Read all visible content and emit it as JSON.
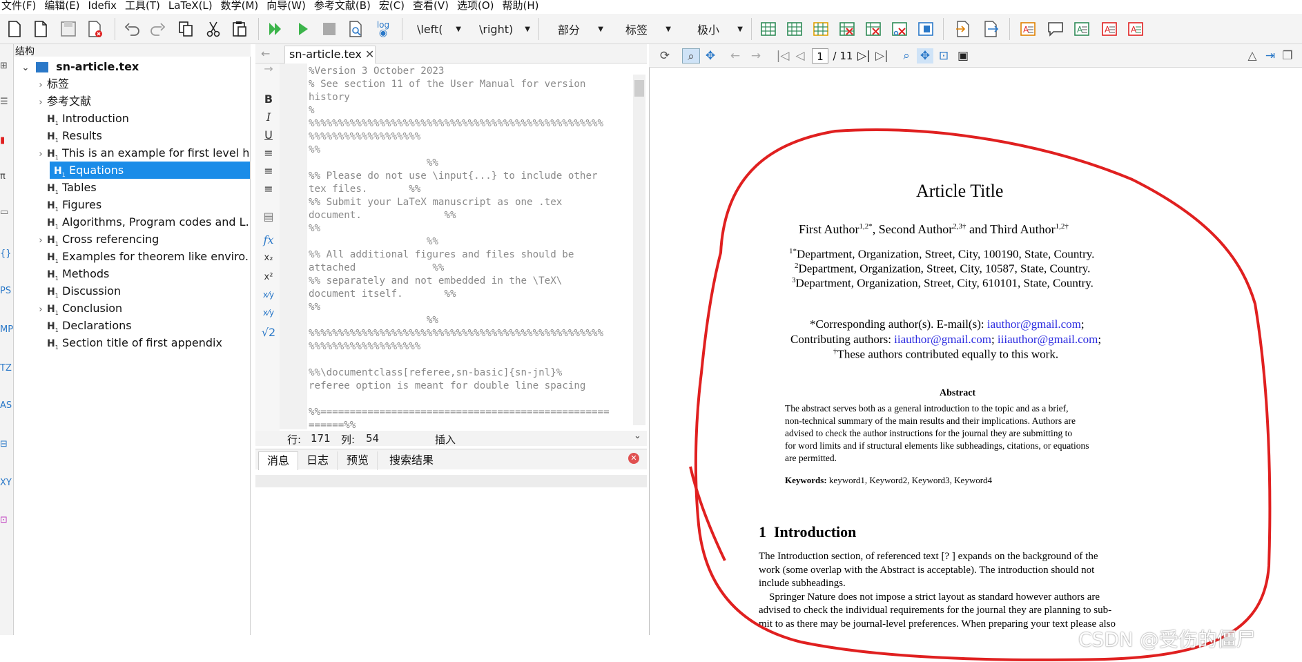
{
  "menu": [
    "文件(F)",
    "编辑(E)",
    "Idefix",
    "工具(T)",
    "LaTeX(L)",
    "数学(M)",
    "向导(W)",
    "参考文献(B)",
    "宏(C)",
    "查看(V)",
    "选项(O)",
    "帮助(H)"
  ],
  "toolbar": {
    "left_combo": "\\left(",
    "right_combo": "\\right)",
    "section_combo": "部分",
    "label_combo": "标签",
    "size_combo": "极小",
    "log_label": "log"
  },
  "structure": {
    "title": "结构",
    "root": "sn-article.tex",
    "items": [
      {
        "label": "标签",
        "kind": "folder",
        "expandable": true
      },
      {
        "label": "参考文献",
        "kind": "folder",
        "expandable": true
      },
      {
        "label": "Introduction",
        "kind": "heading",
        "expandable": false
      },
      {
        "label": "Results",
        "kind": "heading",
        "expandable": false
      },
      {
        "label": "This is an example for first level h...",
        "kind": "heading",
        "expandable": true
      },
      {
        "label": "Equations",
        "kind": "heading",
        "expandable": false,
        "selected": true
      },
      {
        "label": "Tables",
        "kind": "heading",
        "expandable": false
      },
      {
        "label": "Figures",
        "kind": "heading",
        "expandable": false
      },
      {
        "label": "Algorithms, Program codes and L...",
        "kind": "heading",
        "expandable": false
      },
      {
        "label": "Cross referencing",
        "kind": "heading",
        "expandable": true
      },
      {
        "label": "Examples for theorem like enviro...",
        "kind": "heading",
        "expandable": false
      },
      {
        "label": "Methods",
        "kind": "heading",
        "expandable": false
      },
      {
        "label": "Discussion",
        "kind": "heading",
        "expandable": false
      },
      {
        "label": "Conclusion",
        "kind": "heading",
        "expandable": true
      },
      {
        "label": "Declarations",
        "kind": "heading",
        "expandable": false
      },
      {
        "label": "Section title of first appendix",
        "kind": "heading",
        "expandable": false
      }
    ]
  },
  "editor": {
    "tab": "sn-article.tex",
    "lines": [
      "%Version 3 October 2023",
      "% See section 11 of the User Manual for version",
      "history",
      "%",
      "%%%%%%%%%%%%%%%%%%%%%%%%%%%%%%%%%%%%%%%%%%%%%%%%%%",
      "%%%%%%%%%%%%%%%%%%%",
      "%%",
      "                    %%",
      "%% Please do not use \\input{...} to include other",
      "tex files.       %%",
      "%% Submit your LaTeX manuscript as one .tex",
      "document.              %%",
      "%%",
      "                    %%",
      "%% All additional figures and files should be",
      "attached             %%",
      "%% separately and not embedded in the \\TeX\\",
      "document itself.       %%",
      "%%",
      "                    %%",
      "%%%%%%%%%%%%%%%%%%%%%%%%%%%%%%%%%%%%%%%%%%%%%%%%%%",
      "%%%%%%%%%%%%%%%%%%%",
      "",
      "%%\\documentclass[referee,sn-basic]{sn-jnl}%",
      "referee option is meant for double line spacing",
      "",
      "%%=================================================",
      "======%%"
    ],
    "status_row_label": "行:",
    "status_row": "171",
    "status_col_label": "列:",
    "status_col": "54",
    "status_mode": "插入"
  },
  "bottom_tabs": [
    "消息",
    "日志",
    "预览",
    "搜索结果"
  ],
  "pdf_viewer": {
    "page_current": "1",
    "page_total": "/ 11"
  },
  "document": {
    "title": "Article Title",
    "authors": "First Author",
    "author1_sup": "1,2*",
    "author2": "Second Author",
    "author2_sup": "2,3†",
    "author3": "and Third Author",
    "author3_sup": "1,2†",
    "affil1_sup": "1*",
    "affil1": "Department, Organization, Street, City, 100190, State, Country.",
    "affil2_sup": "2",
    "affil2": "Department, Organization, Street, City, 10587, State, Country.",
    "affil3_sup": "3",
    "affil3": "Department, Organization, Street, City, 610101, State, Country.",
    "corr_prefix": "*Corresponding author(s). E-mail(s):",
    "corr_email": "iauthor@gmail.com",
    "contrib_prefix": "Contributing authors:",
    "contrib_email1": "iiauthor@gmail.com",
    "contrib_email2": "iiiauthor@gmail.com",
    "equal_sup": "†",
    "equal": "These authors contributed equally to this work.",
    "abstract_heading": "Abstract",
    "abstract_lines": [
      "The abstract serves both as a general introduction to the topic and as a brief,",
      "non-technical summary of the main results and their implications. Authors are",
      "advised to check the author instructions for the journal they are submitting to",
      "for word limits and if structural elements like subheadings, citations, or equations",
      "are permitted."
    ],
    "keywords_label": "Keywords:",
    "keywords": "keyword1, Keyword2, Keyword3, Keyword4",
    "section_num": "1",
    "section_title": "Introduction",
    "body_lines": [
      "The Introduction section, of referenced text [? ] expands on the background of the",
      "work (some overlap with the Abstract is acceptable). The introduction should not",
      "include subheadings.",
      "    Springer Nature does not impose a strict layout as standard however authors are",
      "advised to check the individual requirements for the journal they are planning to sub-",
      "mit to as there may be journal-level preferences. When preparing your text please also"
    ]
  },
  "watermark": "CSDN @受伤的僵尸",
  "colors": {
    "selection": "#1a8ce8",
    "link": "#2a2ae0",
    "annotation": "#e02020",
    "comment": "#8a8a8a"
  }
}
